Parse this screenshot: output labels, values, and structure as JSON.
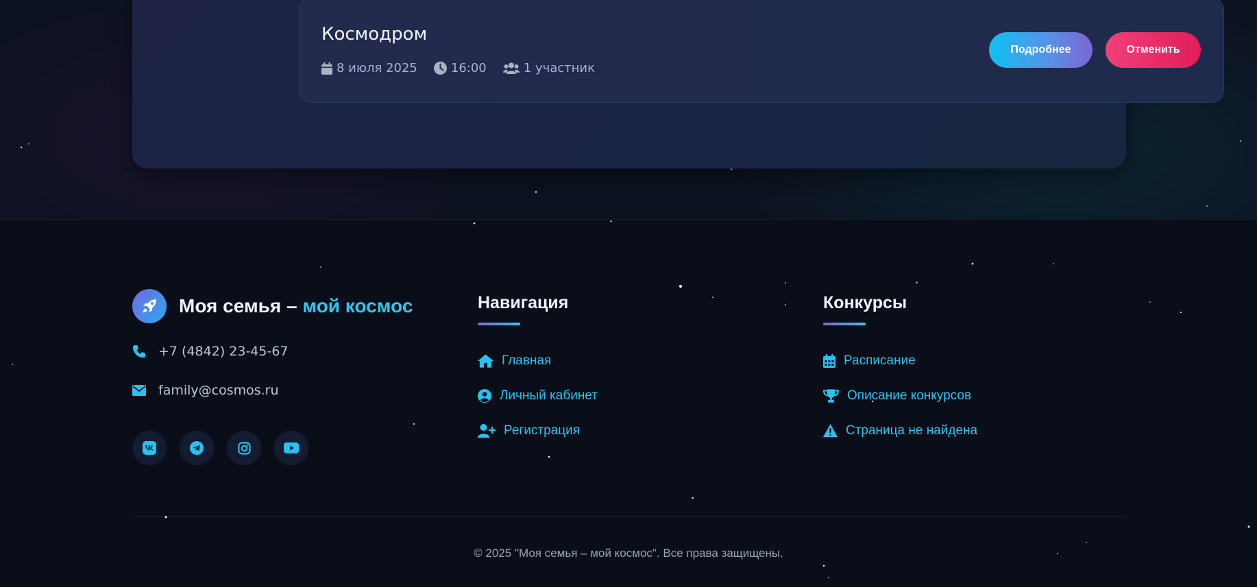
{
  "booking": {
    "title": "Космодром",
    "date": "8 июля 2025",
    "time": "16:00",
    "participants": "1 участник",
    "details_label": "Подробнее",
    "cancel_label": "Отменить"
  },
  "footer": {
    "brand_part1": "Моя семья – ",
    "brand_part2": "мой космос",
    "brand_icon": "rocket-icon",
    "phone": "+7 (4842) 23-45-67",
    "email": "family@cosmos.ru",
    "socials": [
      "vk-icon",
      "telegram-icon",
      "instagram-icon",
      "youtube-icon"
    ],
    "navigation": {
      "title": "Навигация",
      "links": [
        {
          "label": "Главная",
          "icon": "home-icon"
        },
        {
          "label": "Личный кабинет",
          "icon": "user-circle-icon"
        },
        {
          "label": "Регистрация",
          "icon": "user-plus-icon"
        }
      ]
    },
    "contests": {
      "title": "Конкурсы",
      "links": [
        {
          "label": "Расписание",
          "icon": "calendar-icon"
        },
        {
          "label": "Описание конкурсов",
          "icon": "trophy-icon"
        },
        {
          "label": "Страница не найдена",
          "icon": "warning-icon"
        }
      ]
    },
    "copyright": "© 2025 \"Моя семья – мой космос\". Все права защищены."
  },
  "colors": {
    "accent": "#24c3f0",
    "cancel": "#e01e5a",
    "background": "#0a0e19"
  }
}
